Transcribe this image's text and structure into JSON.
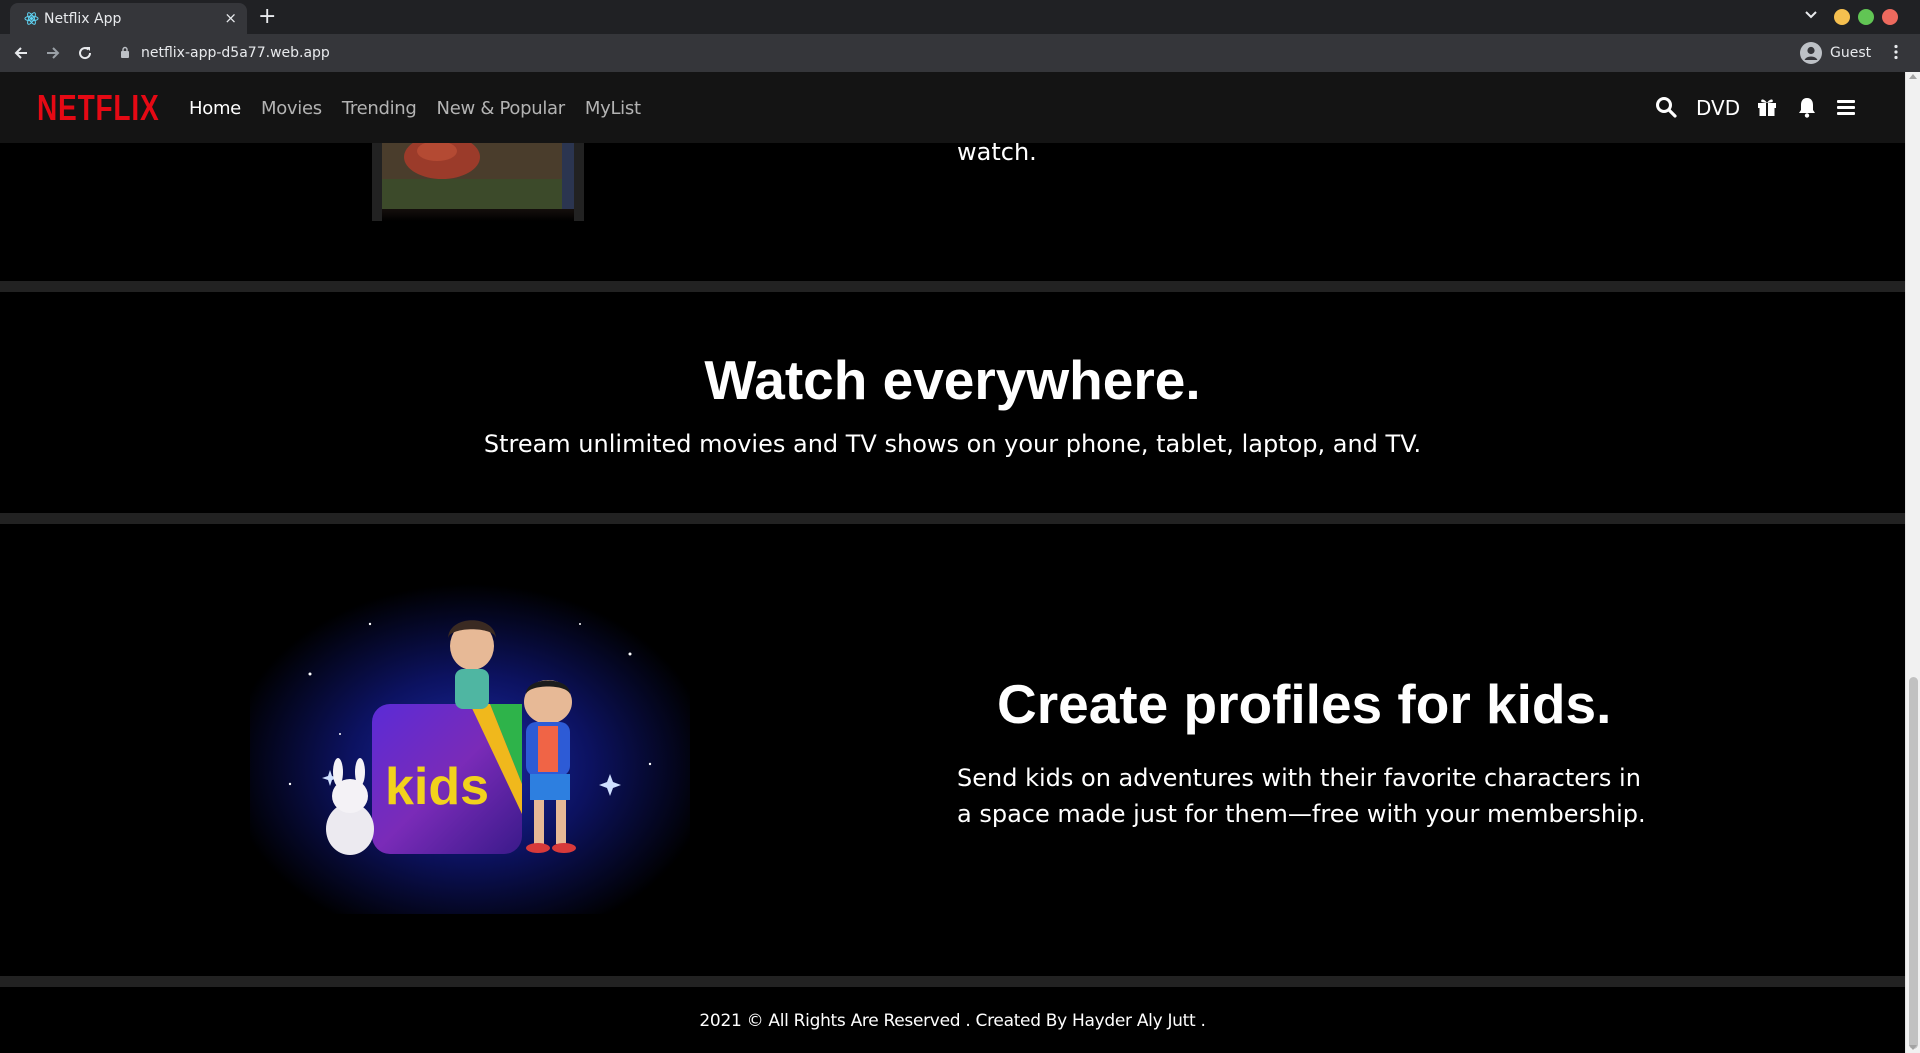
{
  "browser": {
    "tab_title": "Netflix App",
    "tab_close": "×",
    "new_tab": "+",
    "url": "netflix-app-d5a77.web.app",
    "profile_name": "Guest",
    "window_colors": {
      "minimize": "#f5bf4f",
      "maximize": "#61c554",
      "close": "#ed6a5e"
    }
  },
  "header": {
    "logo": "NETFLIX",
    "nav": [
      "Home",
      "Movies",
      "Trending",
      "New & Popular",
      "MyList"
    ],
    "active_nav": "Home",
    "dvd": "DVD",
    "icons": [
      "search-icon",
      "gift-icon",
      "bell-icon",
      "menu-icon"
    ]
  },
  "sections": {
    "top": {
      "text_fragment": "watch."
    },
    "watch": {
      "title": "Watch everywhere.",
      "subtitle": "Stream unlimited movies and TV shows on your phone, tablet, laptop, and TV."
    },
    "kids": {
      "title": "Create profiles for kids.",
      "subtitle": "Send kids on adventures with their favorite characters in a space made just for them—free with your membership.",
      "image_badge": "kids"
    }
  },
  "footer": {
    "text": "2021 © All Rights Are Reserved . Created By Hayder Aly Jutt ."
  },
  "colors": {
    "brand_red": "#e50914",
    "header_bg": "#141414",
    "divider": "#222222"
  }
}
